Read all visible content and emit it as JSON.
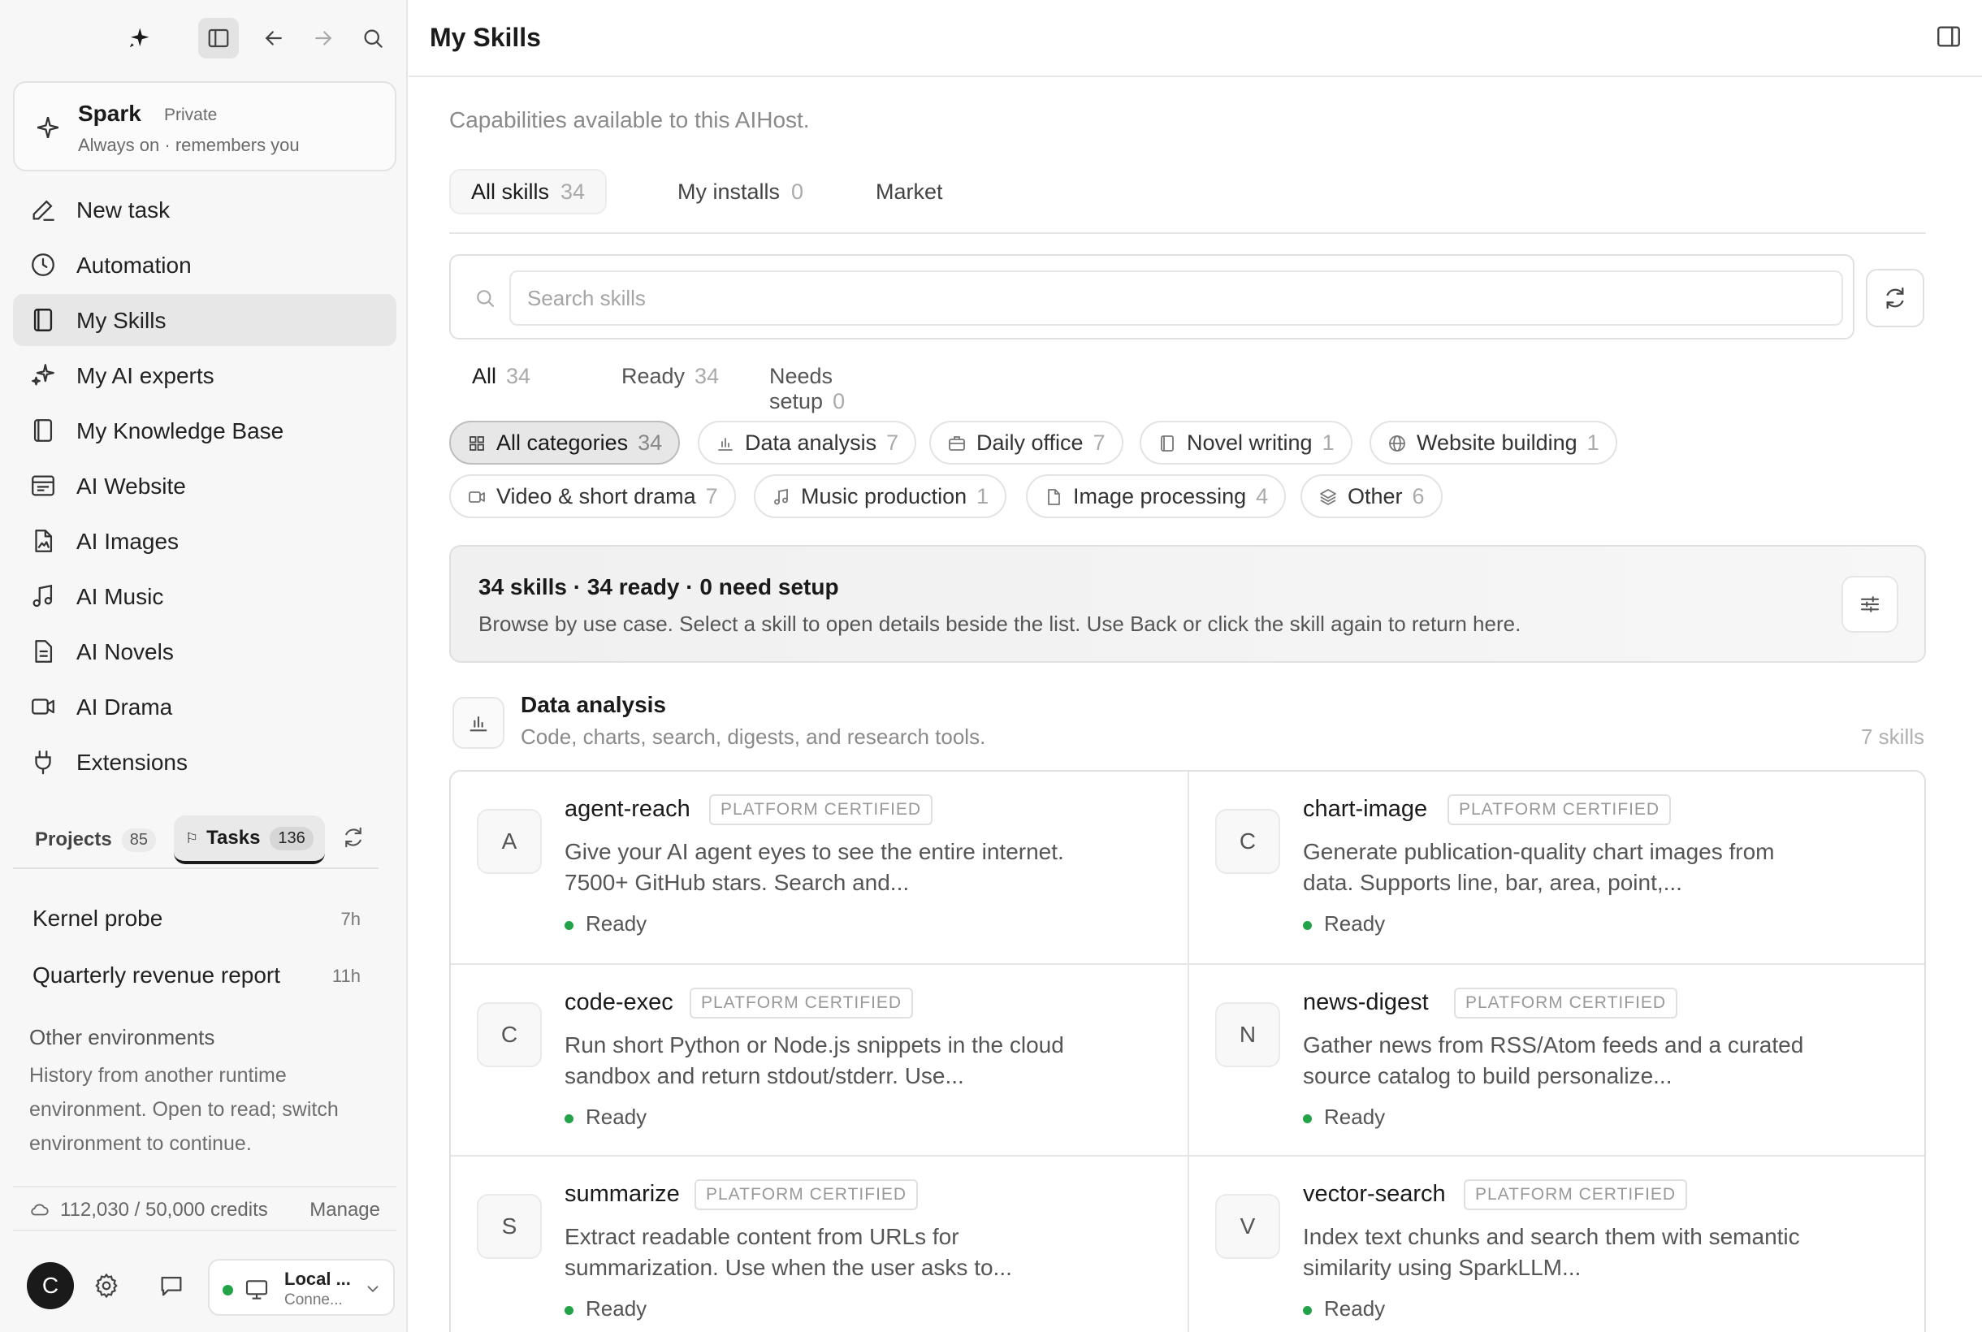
{
  "sidebar": {
    "spark": {
      "name": "Spark",
      "badge": "Private",
      "subtitle": "Always on · remembers you"
    },
    "nav": [
      {
        "label": "New task",
        "icon": "pencil-icon"
      },
      {
        "label": "Automation",
        "icon": "clock-icon"
      },
      {
        "label": "My Skills",
        "icon": "book-icon",
        "active": true
      },
      {
        "label": "My AI experts",
        "icon": "sparkles-icon"
      },
      {
        "label": "My Knowledge Base",
        "icon": "book-icon"
      },
      {
        "label": "AI Website",
        "icon": "website-icon"
      },
      {
        "label": "AI Images",
        "icon": "image-file-icon"
      },
      {
        "label": "AI Music",
        "icon": "music-icon"
      },
      {
        "label": "AI Novels",
        "icon": "document-icon"
      },
      {
        "label": "AI Drama",
        "icon": "video-icon"
      },
      {
        "label": "Extensions",
        "icon": "plug-icon"
      }
    ],
    "project_tabs": {
      "projects_label": "Projects",
      "projects_count": "85",
      "tasks_label": "Tasks",
      "tasks_count": "136"
    },
    "tasks": [
      {
        "name": "Kernel probe",
        "time": "7h"
      },
      {
        "name": "Quarterly revenue report",
        "time": "11h"
      }
    ],
    "other_env": {
      "title": "Other environments",
      "text": "History from another runtime environment. Open to read; switch environment to continue."
    },
    "credits": {
      "text": "112,030 / 50,000 credits",
      "manage": "Manage"
    },
    "user": {
      "initial": "C"
    },
    "environment": {
      "name": "Local ...",
      "status": "Conne..."
    }
  },
  "main": {
    "title": "My Skills",
    "subtitle": "Capabilities available to this AIHost.",
    "tabs": [
      {
        "label": "All skills",
        "count": "34"
      },
      {
        "label": "My installs",
        "count": "0"
      },
      {
        "label": "Market",
        "count": ""
      }
    ],
    "search": {
      "placeholder": "Search skills"
    },
    "status_tabs": [
      {
        "label": "All",
        "count": "34"
      },
      {
        "label": "Ready",
        "count": "34"
      },
      {
        "label": "Needs setup",
        "count": "0"
      }
    ],
    "categories": [
      {
        "label": "All categories",
        "count": "34",
        "icon": "grid-icon"
      },
      {
        "label": "Data analysis",
        "count": "7",
        "icon": "bar-chart-icon"
      },
      {
        "label": "Daily office",
        "count": "7",
        "icon": "briefcase-icon"
      },
      {
        "label": "Novel writing",
        "count": "1",
        "icon": "book-icon"
      },
      {
        "label": "Website building",
        "count": "1",
        "icon": "globe-icon"
      },
      {
        "label": "Video & short drama",
        "count": "7",
        "icon": "video-icon"
      },
      {
        "label": "Music production",
        "count": "1",
        "icon": "music-icon"
      },
      {
        "label": "Image processing",
        "count": "4",
        "icon": "image-file-icon"
      },
      {
        "label": "Other",
        "count": "6",
        "icon": "layers-icon"
      }
    ],
    "summary": {
      "title": "34 skills · 34 ready · 0 need setup",
      "description": "Browse by use case. Select a skill to open details beside the list. Use Back or click the skill again to return here."
    },
    "section": {
      "title": "Data analysis",
      "description": "Code, charts, search, digests, and research tools.",
      "count": "7 skills"
    },
    "skills": [
      {
        "initial": "A",
        "name": "agent-reach",
        "badge": "PLATFORM CERTIFIED",
        "description": "Give your AI agent eyes to see the entire internet. 7500+ GitHub stars. Search and...",
        "status": "Ready"
      },
      {
        "initial": "C",
        "name": "chart-image",
        "badge": "PLATFORM CERTIFIED",
        "description": "Generate publication-quality chart images from data. Supports line, bar, area, point,...",
        "status": "Ready"
      },
      {
        "initial": "C",
        "name": "code-exec",
        "badge": "PLATFORM CERTIFIED",
        "description": "Run short Python or Node.js snippets in the cloud sandbox and return stdout/stderr. Use...",
        "status": "Ready"
      },
      {
        "initial": "N",
        "name": "news-digest",
        "badge": "PLATFORM CERTIFIED",
        "description": "Gather news from RSS/Atom feeds and a curated source catalog to build personalize...",
        "status": "Ready"
      },
      {
        "initial": "S",
        "name": "summarize",
        "badge": "PLATFORM CERTIFIED",
        "description": "Extract readable content from URLs for summarization. Use when the user asks to...",
        "status": "Ready"
      },
      {
        "initial": "V",
        "name": "vector-search",
        "badge": "PLATFORM CERTIFIED",
        "description": "Index text chunks and search them with semantic similarity using SparkLLM...",
        "status": "Ready"
      }
    ],
    "colors": {
      "ready_dot": "#22a348",
      "active_bg": "#e7e7e7",
      "text": "#1a1a1a"
    }
  }
}
